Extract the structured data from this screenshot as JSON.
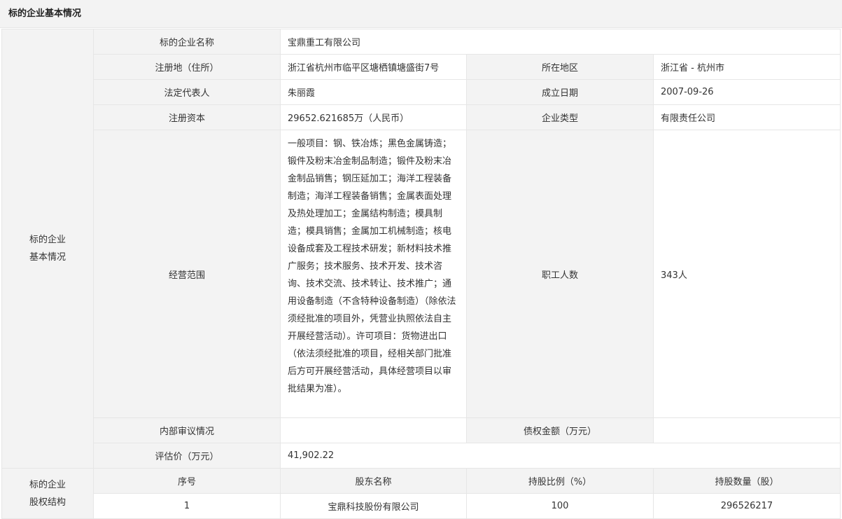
{
  "title": "标的企业基本情况",
  "basic": {
    "section_label_1": "标的企业",
    "section_label_2": "基本情况",
    "company_name_label": "标的企业名称",
    "company_name": "宝鼎重工有限公司",
    "reg_address_label": "注册地（住所）",
    "reg_address": "浙江省杭州市临平区塘栖镇塘盛街7号",
    "region_label": "所在地区",
    "region": "浙江省 - 杭州市",
    "legal_rep_label": "法定代表人",
    "legal_rep": "朱丽霞",
    "founded_label": "成立日期",
    "founded": "2007-09-26",
    "capital_label": "注册资本",
    "capital": "29652.621685万（人民币）",
    "company_type_label": "企业类型",
    "company_type": "有限责任公司",
    "scope_label": "经营范围",
    "scope": "一般项目：钢、铁冶炼；黑色金属铸造；锻件及粉末冶金制品制造；锻件及粉末冶金制品销售；钢压延加工；海洋工程装备制造；海洋工程装备销售；金属表面处理及热处理加工；金属结构制造；模具制造；模具销售；金属加工机械制造；核电设备成套及工程技术研发；新材料技术推广服务；技术服务、技术开发、技术咨询、技术交流、技术转让、技术推广；通用设备制造（不含特种设备制造）（除依法须经批准的项目外，凭营业执照依法自主开展经营活动）。许可项目：货物进出口（依法须经批准的项目，经相关部门批准后方可开展经营活动，具体经营项目以审批结果为准）。",
    "employees_label": "职工人数",
    "employees": "343人",
    "audit_label": "内部审议情况",
    "audit": "",
    "debt_label": "债权金额（万元）",
    "debt": "",
    "valuation_label": "评估价（万元）",
    "valuation": "41,902.22"
  },
  "equity": {
    "section_label_1": "标的企业",
    "section_label_2": "股权结构",
    "columns": [
      "序号",
      "股东名称",
      "持股比例（%）",
      "持股数量（股）"
    ],
    "rows": [
      [
        "1",
        "宝鼎科技股份有限公司",
        "100",
        "296526217"
      ]
    ]
  }
}
